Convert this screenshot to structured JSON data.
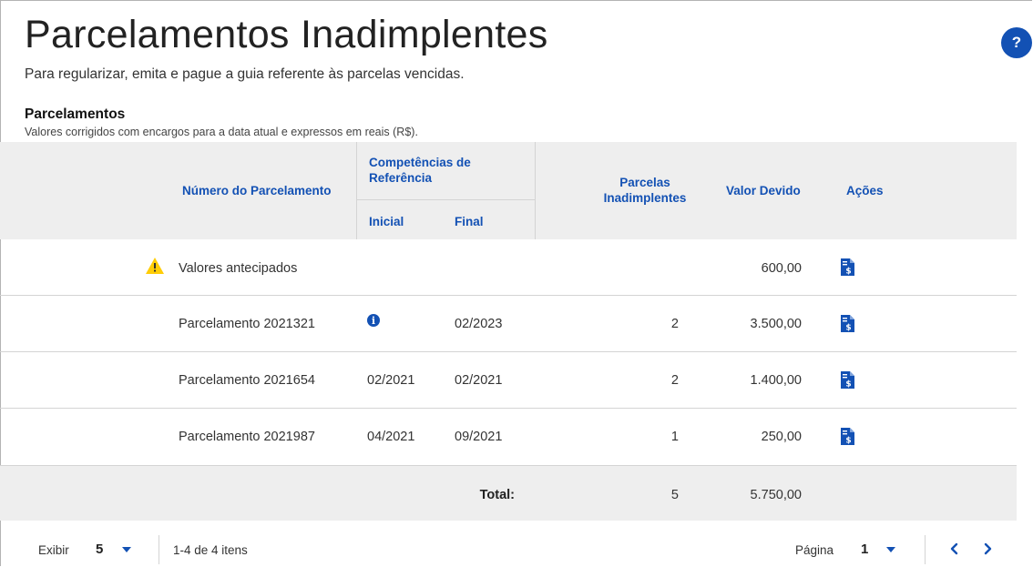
{
  "header": {
    "title": "Parcelamentos Inadimplentes",
    "subtitle": "Para regularizar, emita e pague a guia referente às parcelas vencidas.",
    "help_label": "?"
  },
  "section": {
    "title": "Parcelamentos",
    "subtitle": "Valores corrigidos com encargos para a data atual e expressos em reais (R$)."
  },
  "table": {
    "headers": {
      "numero": "Número do Parcelamento",
      "competencias": "Competências de Referência",
      "inicial": "Inicial",
      "final": "Final",
      "parcelas": "Parcelas Inadimplentes",
      "valor": "Valor Devido",
      "acoes": "Ações"
    },
    "rows": [
      {
        "numero": "Valores antecipados",
        "inicial": "",
        "final": "",
        "parcelas": "",
        "valor": "600,00",
        "warning": true,
        "info": false
      },
      {
        "numero": "Parcelamento 2021321",
        "inicial": "",
        "final": "02/2023",
        "parcelas": "2",
        "valor": "3.500,00",
        "warning": false,
        "info": true
      },
      {
        "numero": "Parcelamento 2021654",
        "inicial": "02/2021",
        "final": "02/2021",
        "parcelas": "2",
        "valor": "1.400,00",
        "warning": false,
        "info": false
      },
      {
        "numero": "Parcelamento 2021987",
        "inicial": "04/2021",
        "final": "09/2021",
        "parcelas": "1",
        "valor": "250,00",
        "warning": false,
        "info": false
      }
    ],
    "total": {
      "label": "Total:",
      "parcelas": "5",
      "valor": "5.750,00"
    }
  },
  "footer": {
    "exibir_label": "Exibir",
    "exibir_value": "5",
    "items_info": "1-4 de 4 itens",
    "pagina_label": "Página",
    "pagina_value": "1"
  },
  "icons": {
    "help": "question-icon",
    "warning": "warning-icon",
    "info": "info-icon",
    "action": "document-dollar-icon",
    "prev": "chevron-left-icon",
    "next": "chevron-right-icon",
    "dropdown": "caret-down-icon"
  },
  "colors": {
    "accent": "#1351b4",
    "warning": "#ffcd07",
    "header_bg": "#eeeeee"
  }
}
